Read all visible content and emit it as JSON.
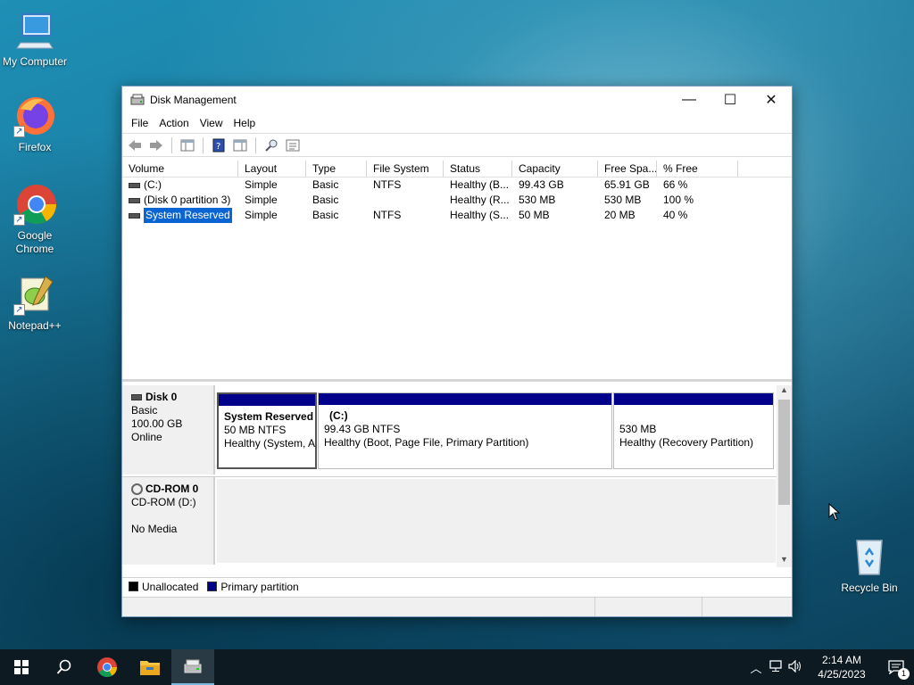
{
  "desktop": {
    "icons": [
      {
        "label": "My Computer"
      },
      {
        "label": "Firefox"
      },
      {
        "label": "Google Chrome"
      },
      {
        "label": "Notepad++"
      },
      {
        "label": "Recycle Bin"
      }
    ]
  },
  "window": {
    "title": "Disk Management",
    "controls": {
      "minimize": "—",
      "maximize": "☐",
      "close": "✕"
    },
    "menu": [
      "File",
      "Action",
      "View",
      "Help"
    ]
  },
  "volume_table": {
    "headers": [
      "Volume",
      "Layout",
      "Type",
      "File System",
      "Status",
      "Capacity",
      "Free Spa...",
      "% Free"
    ],
    "rows": [
      {
        "volume": "(C:)",
        "layout": "Simple",
        "type": "Basic",
        "fs": "NTFS",
        "status": "Healthy (B...",
        "capacity": "99.43 GB",
        "free": "65.91 GB",
        "pct": "66 %"
      },
      {
        "volume": "(Disk 0 partition 3)",
        "layout": "Simple",
        "type": "Basic",
        "fs": "",
        "status": "Healthy (R...",
        "capacity": "530 MB",
        "free": "530 MB",
        "pct": "100 %"
      },
      {
        "volume": "System Reserved",
        "layout": "Simple",
        "type": "Basic",
        "fs": "NTFS",
        "status": "Healthy (S...",
        "capacity": "50 MB",
        "free": "20 MB",
        "pct": "40 %"
      }
    ]
  },
  "disks": [
    {
      "name": "Disk 0",
      "kind": "Basic",
      "size": "100.00 GB",
      "state": "Online",
      "partitions": [
        {
          "name": "System Reserved",
          "line1": "50 MB NTFS",
          "line2": "Healthy (System, A"
        },
        {
          "name": "(C:)",
          "line1": "99.43 GB NTFS",
          "line2": "Healthy (Boot, Page File, Primary Partition)"
        },
        {
          "name": "",
          "line1": "530 MB",
          "line2": "Healthy (Recovery Partition)"
        }
      ]
    },
    {
      "name": "CD-ROM 0",
      "kind": "CD-ROM (D:)",
      "size": "",
      "state": "No Media"
    }
  ],
  "legend": [
    {
      "label": "Unallocated",
      "color": "#000000"
    },
    {
      "label": "Primary partition",
      "color": "#00008b"
    }
  ],
  "taskbar": {
    "time": "2:14 AM",
    "date": "4/25/2023",
    "notification_count": "1"
  },
  "colors": {
    "accent": "#0a64d2",
    "partition_bar": "#00008b"
  }
}
